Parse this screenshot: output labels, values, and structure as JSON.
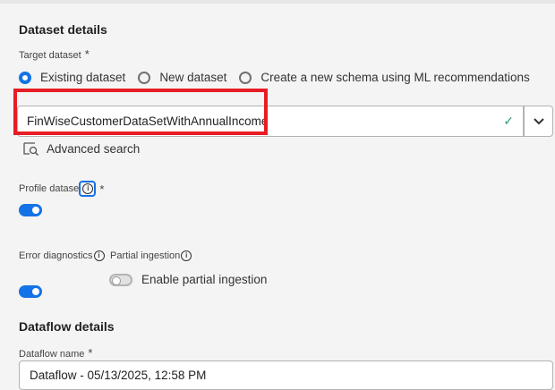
{
  "dataset_details": {
    "title": "Dataset details",
    "target_label": "Target dataset",
    "required": "*",
    "options": [
      "Existing dataset",
      "New dataset",
      "Create a new schema using ML recommendations"
    ],
    "selected": 0,
    "dataset_value": "FinWiseCustomerDataSetWithAnnualIncome",
    "advanced_search": "Advanced search",
    "profile_label": "Profile dataset",
    "profile_enabled": true,
    "error_label": "Error diagnostics",
    "error_enabled": true,
    "partial_label": "Partial ingestion",
    "partial_enabled": false,
    "partial_toggle_label": "Enable partial ingestion",
    "highlight_color": "#e81c24",
    "accent": "#1473e6"
  },
  "dataflow_details": {
    "title": "Dataflow details",
    "name_label": "Dataflow name",
    "required": "*",
    "name_value": "Dataflow - 05/13/2025, 12:58 PM"
  }
}
